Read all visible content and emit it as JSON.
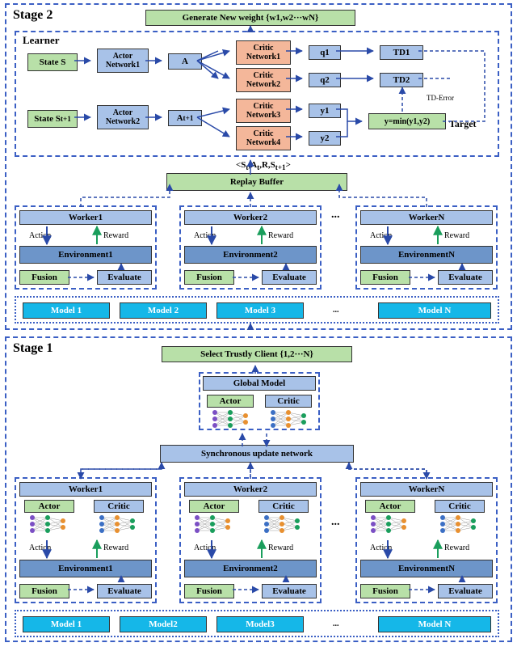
{
  "stage2": {
    "title": "Stage 2",
    "generate_weight": "Generate New weight {w1,w2···wN}",
    "learner": {
      "title": "Learner",
      "state_s": "State S",
      "state_st1": "State S",
      "state_st1_sub": "t+1",
      "actor1": "Actor Network1",
      "actor2": "Actor Network2",
      "A": "A",
      "At1": "A",
      "At1_sub": "t+1",
      "critic1": "Critic Network1",
      "critic2": "Critic Network2",
      "critic3": "Critic Network3",
      "critic4": "Critic Network4",
      "q1": "q1",
      "q2": "q2",
      "y1": "y1",
      "y2": "y2",
      "td1": "TD1",
      "td2": "TD2",
      "td_error": "TD-Error",
      "target_y": "y=min(y1,y2)",
      "target_label": "Target"
    },
    "replay_buffer": "Replay Buffer",
    "tuple": "<S",
    "tuple_parts": [
      "t",
      ",A",
      "t",
      ",R,S",
      "t+1",
      ">"
    ],
    "workers": [
      "Worker1",
      "Worker2",
      "WorkerN"
    ],
    "environments": [
      "Environment1",
      "Environment2",
      "EnvironmentN"
    ],
    "action": "Action",
    "reward": "Reward",
    "fusion": "Fusion",
    "evaluate": "Evaluate",
    "ellipsis": "...",
    "models_row": [
      "Model 1",
      "Model 2",
      "Model 3",
      "...",
      "Model N"
    ]
  },
  "stage1": {
    "title": "Stage 1",
    "select_client": "Select Trustly Client {1,2···N}",
    "global_model": "Global Model",
    "actor": "Actor",
    "critic": "Critic",
    "sync_network": "Synchronous update network",
    "workers": [
      "Worker1",
      "Worker2",
      "WorkerN"
    ],
    "environments": [
      "Environment1",
      "Environment2",
      "EnvironmentN"
    ],
    "action": "Action",
    "reward": "Reward",
    "fusion": "Fusion",
    "evaluate": "Evaluate",
    "ellipsis": "...",
    "models_row": [
      "Model 1",
      "Model2",
      "Model3",
      "...",
      "Model N"
    ]
  },
  "colors": {
    "green": "#b8e0a8",
    "blue": "#a8c2e8",
    "steel": "#6d95c9",
    "peach": "#f4b79a",
    "cyan": "#15b7e8",
    "dash": "#3b5fc4"
  }
}
